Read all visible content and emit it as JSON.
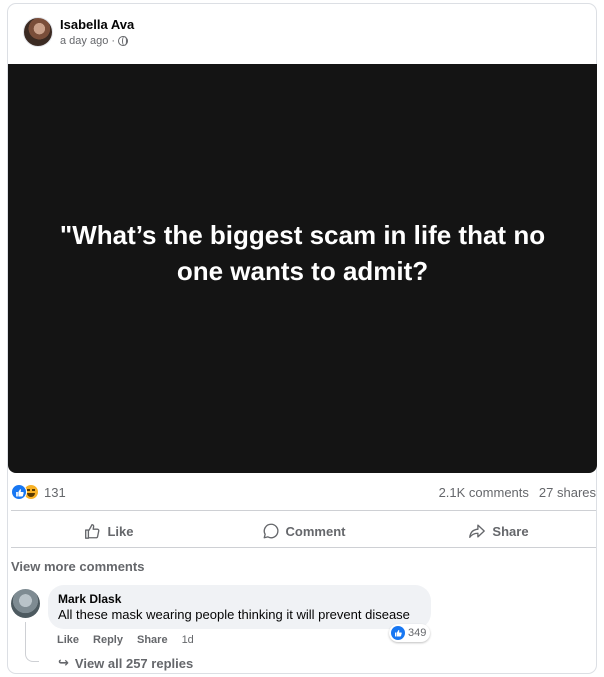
{
  "post": {
    "author": "Isabella Ava",
    "time": "a day ago",
    "separator": "·",
    "privacy_icon": "globe-icon",
    "media_text": "\"What’s the biggest scam in life that no one wants to admit?"
  },
  "stats": {
    "reaction_icons": [
      "like-icon",
      "haha-icon"
    ],
    "reactions_count": "131",
    "comments": "2.1K comments",
    "shares": "27 shares"
  },
  "actions": {
    "like": "Like",
    "comment": "Comment",
    "share": "Share"
  },
  "comments_section": {
    "view_more": "View more comments",
    "comment": {
      "author": "Mark Dlask",
      "text": "All these mask wearing people thinking it will prevent disease",
      "reaction_count": "349",
      "like_label": "Like",
      "reply_label": "Reply",
      "share_label": "Share",
      "time": "1d",
      "view_replies": "View all 257 replies"
    }
  },
  "colors": {
    "brand_blue": "#1877f2",
    "muted_text": "#65676b",
    "media_background": "#141414"
  }
}
